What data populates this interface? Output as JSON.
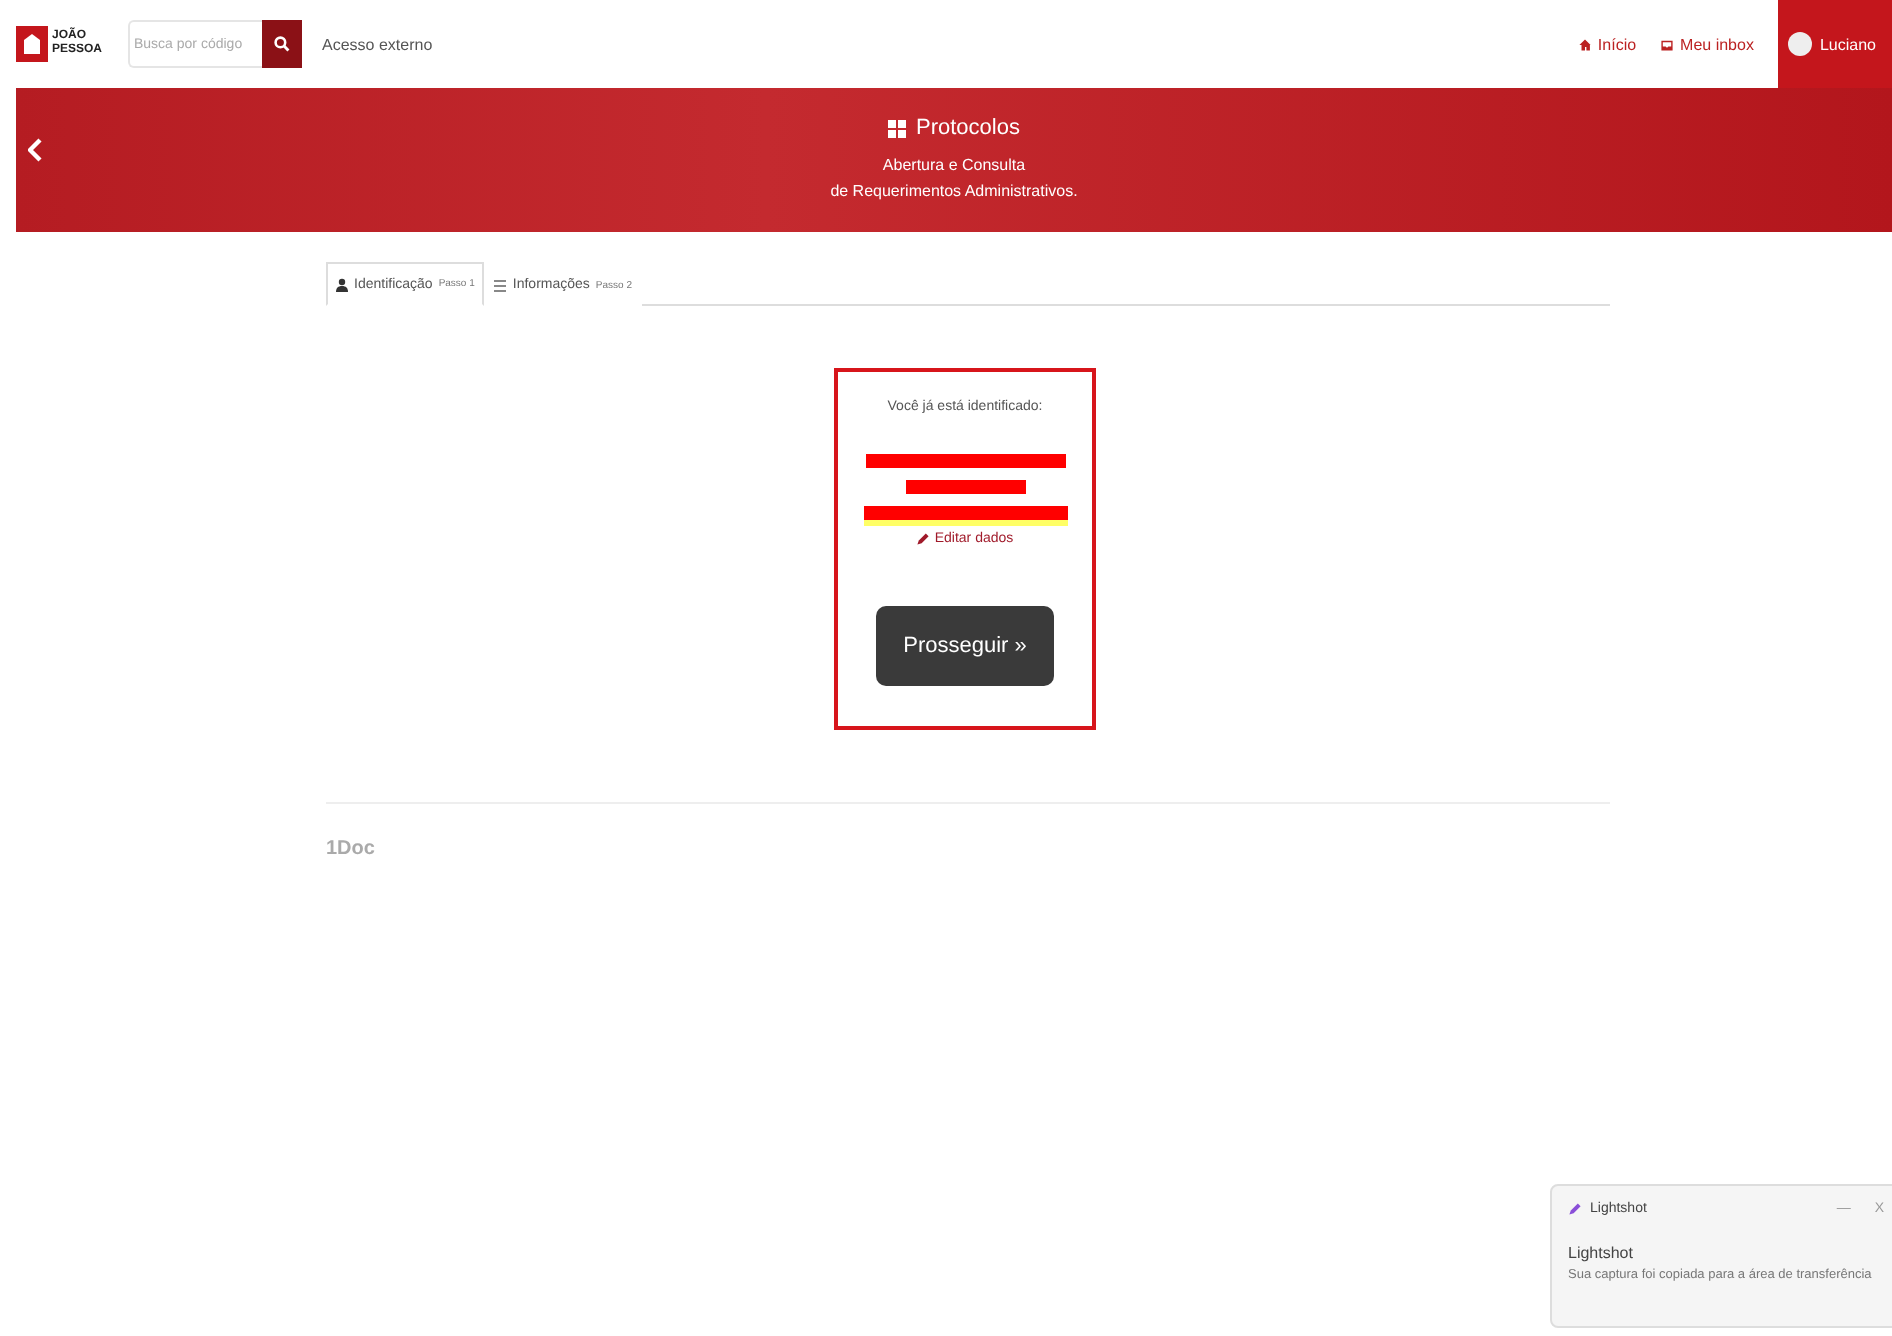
{
  "header": {
    "logo_text": "JOÃO PESSOA",
    "search": {
      "placeholder": "Busca por código"
    },
    "external_link": "Acesso externo",
    "nav": [
      {
        "label": "Início",
        "kind": "home"
      },
      {
        "label": "Meu inbox",
        "kind": "inbox"
      }
    ],
    "user": "Luciano"
  },
  "banner": {
    "title": "Protocolos",
    "subtitle_lines": [
      "Abertura e Consulta",
      "de Requerimentos Administrativos."
    ]
  },
  "tabs": [
    {
      "label": "Identificação",
      "step": "Passo 1",
      "kind": "user",
      "selected": true
    },
    {
      "label": "Informações",
      "step": "Passo 2",
      "kind": "list",
      "selected": false
    }
  ],
  "card": {
    "heading": "Você já está identificado:",
    "edit_link": "Editar dados",
    "button": "Prosseguir »"
  },
  "footer": {
    "brand": "1Doc"
  },
  "toast": {
    "app": "Lightshot",
    "minimize": "—",
    "close": "X",
    "title": "Lightshot",
    "message": "Sua captura foi copiada para a área de transferência"
  }
}
